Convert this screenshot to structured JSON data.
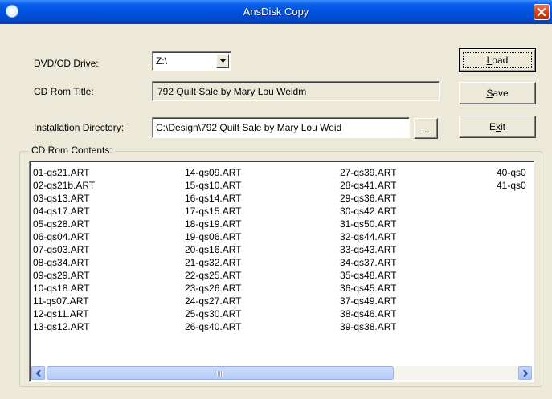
{
  "window": {
    "title": "AnsDisk Copy"
  },
  "drive": {
    "label": "DVD/CD Drive:",
    "value": "Z:\\"
  },
  "cd_title": {
    "label": "CD Rom Title:",
    "value": "792 Quilt Sale by Mary Lou Weidm"
  },
  "install_dir": {
    "label": "Installation Directory:",
    "value": "C:\\Design\\792 Quilt Sale by Mary Lou Weid",
    "browse_label": "..."
  },
  "buttons": {
    "load": "Load",
    "save": "Save",
    "exit": "Exit"
  },
  "contents": {
    "label": "CD Rom Contents:",
    "columns": [
      [
        "01-qs21.ART",
        "02-qs21b.ART",
        "03-qs13.ART",
        "04-qs17.ART",
        "05-qs28.ART",
        "06-qs04.ART",
        "07-qs03.ART",
        "08-qs34.ART",
        "09-qs29.ART",
        "10-qs18.ART",
        "11-qs07.ART",
        "12-qs11.ART",
        "13-qs12.ART"
      ],
      [
        "14-qs09.ART",
        "15-qs10.ART",
        "16-qs14.ART",
        "17-qs15.ART",
        "18-qs19.ART",
        "19-qs06.ART",
        "20-qs16.ART",
        "21-qs32.ART",
        "22-qs25.ART",
        "23-qs26.ART",
        "24-qs27.ART",
        "25-qs30.ART",
        "26-qs40.ART"
      ],
      [
        "27-qs39.ART",
        "28-qs41.ART",
        "29-qs36.ART",
        "30-qs42.ART",
        "31-qs50.ART",
        "32-qs44.ART",
        "33-qs43.ART",
        "34-qs37.ART",
        "35-qs48.ART",
        "36-qs45.ART",
        "37-qs49.ART",
        "38-qs46.ART",
        "39-qs38.ART"
      ],
      [
        "40-qs0",
        "41-qs0"
      ]
    ]
  }
}
